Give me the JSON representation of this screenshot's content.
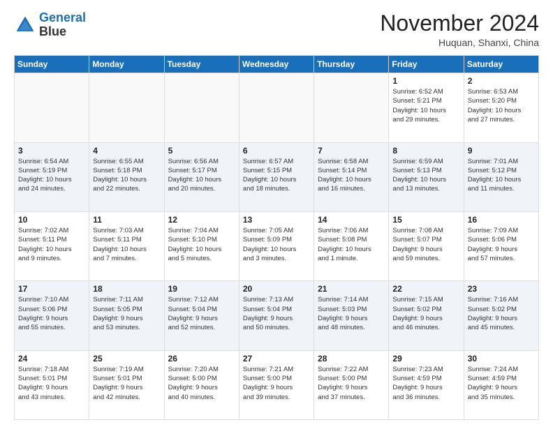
{
  "header": {
    "logo_line1": "General",
    "logo_line2": "Blue",
    "month": "November 2024",
    "location": "Huquan, Shanxi, China"
  },
  "weekdays": [
    "Sunday",
    "Monday",
    "Tuesday",
    "Wednesday",
    "Thursday",
    "Friday",
    "Saturday"
  ],
  "weeks": [
    [
      {
        "day": "",
        "detail": ""
      },
      {
        "day": "",
        "detail": ""
      },
      {
        "day": "",
        "detail": ""
      },
      {
        "day": "",
        "detail": ""
      },
      {
        "day": "",
        "detail": ""
      },
      {
        "day": "1",
        "detail": "Sunrise: 6:52 AM\nSunset: 5:21 PM\nDaylight: 10 hours\nand 29 minutes."
      },
      {
        "day": "2",
        "detail": "Sunrise: 6:53 AM\nSunset: 5:20 PM\nDaylight: 10 hours\nand 27 minutes."
      }
    ],
    [
      {
        "day": "3",
        "detail": "Sunrise: 6:54 AM\nSunset: 5:19 PM\nDaylight: 10 hours\nand 24 minutes."
      },
      {
        "day": "4",
        "detail": "Sunrise: 6:55 AM\nSunset: 5:18 PM\nDaylight: 10 hours\nand 22 minutes."
      },
      {
        "day": "5",
        "detail": "Sunrise: 6:56 AM\nSunset: 5:17 PM\nDaylight: 10 hours\nand 20 minutes."
      },
      {
        "day": "6",
        "detail": "Sunrise: 6:57 AM\nSunset: 5:15 PM\nDaylight: 10 hours\nand 18 minutes."
      },
      {
        "day": "7",
        "detail": "Sunrise: 6:58 AM\nSunset: 5:14 PM\nDaylight: 10 hours\nand 16 minutes."
      },
      {
        "day": "8",
        "detail": "Sunrise: 6:59 AM\nSunset: 5:13 PM\nDaylight: 10 hours\nand 13 minutes."
      },
      {
        "day": "9",
        "detail": "Sunrise: 7:01 AM\nSunset: 5:12 PM\nDaylight: 10 hours\nand 11 minutes."
      }
    ],
    [
      {
        "day": "10",
        "detail": "Sunrise: 7:02 AM\nSunset: 5:11 PM\nDaylight: 10 hours\nand 9 minutes."
      },
      {
        "day": "11",
        "detail": "Sunrise: 7:03 AM\nSunset: 5:11 PM\nDaylight: 10 hours\nand 7 minutes."
      },
      {
        "day": "12",
        "detail": "Sunrise: 7:04 AM\nSunset: 5:10 PM\nDaylight: 10 hours\nand 5 minutes."
      },
      {
        "day": "13",
        "detail": "Sunrise: 7:05 AM\nSunset: 5:09 PM\nDaylight: 10 hours\nand 3 minutes."
      },
      {
        "day": "14",
        "detail": "Sunrise: 7:06 AM\nSunset: 5:08 PM\nDaylight: 10 hours\nand 1 minute."
      },
      {
        "day": "15",
        "detail": "Sunrise: 7:08 AM\nSunset: 5:07 PM\nDaylight: 9 hours\nand 59 minutes."
      },
      {
        "day": "16",
        "detail": "Sunrise: 7:09 AM\nSunset: 5:06 PM\nDaylight: 9 hours\nand 57 minutes."
      }
    ],
    [
      {
        "day": "17",
        "detail": "Sunrise: 7:10 AM\nSunset: 5:06 PM\nDaylight: 9 hours\nand 55 minutes."
      },
      {
        "day": "18",
        "detail": "Sunrise: 7:11 AM\nSunset: 5:05 PM\nDaylight: 9 hours\nand 53 minutes."
      },
      {
        "day": "19",
        "detail": "Sunrise: 7:12 AM\nSunset: 5:04 PM\nDaylight: 9 hours\nand 52 minutes."
      },
      {
        "day": "20",
        "detail": "Sunrise: 7:13 AM\nSunset: 5:04 PM\nDaylight: 9 hours\nand 50 minutes."
      },
      {
        "day": "21",
        "detail": "Sunrise: 7:14 AM\nSunset: 5:03 PM\nDaylight: 9 hours\nand 48 minutes."
      },
      {
        "day": "22",
        "detail": "Sunrise: 7:15 AM\nSunset: 5:02 PM\nDaylight: 9 hours\nand 46 minutes."
      },
      {
        "day": "23",
        "detail": "Sunrise: 7:16 AM\nSunset: 5:02 PM\nDaylight: 9 hours\nand 45 minutes."
      }
    ],
    [
      {
        "day": "24",
        "detail": "Sunrise: 7:18 AM\nSunset: 5:01 PM\nDaylight: 9 hours\nand 43 minutes."
      },
      {
        "day": "25",
        "detail": "Sunrise: 7:19 AM\nSunset: 5:01 PM\nDaylight: 9 hours\nand 42 minutes."
      },
      {
        "day": "26",
        "detail": "Sunrise: 7:20 AM\nSunset: 5:00 PM\nDaylight: 9 hours\nand 40 minutes."
      },
      {
        "day": "27",
        "detail": "Sunrise: 7:21 AM\nSunset: 5:00 PM\nDaylight: 9 hours\nand 39 minutes."
      },
      {
        "day": "28",
        "detail": "Sunrise: 7:22 AM\nSunset: 5:00 PM\nDaylight: 9 hours\nand 37 minutes."
      },
      {
        "day": "29",
        "detail": "Sunrise: 7:23 AM\nSunset: 4:59 PM\nDaylight: 9 hours\nand 36 minutes."
      },
      {
        "day": "30",
        "detail": "Sunrise: 7:24 AM\nSunset: 4:59 PM\nDaylight: 9 hours\nand 35 minutes."
      }
    ]
  ]
}
